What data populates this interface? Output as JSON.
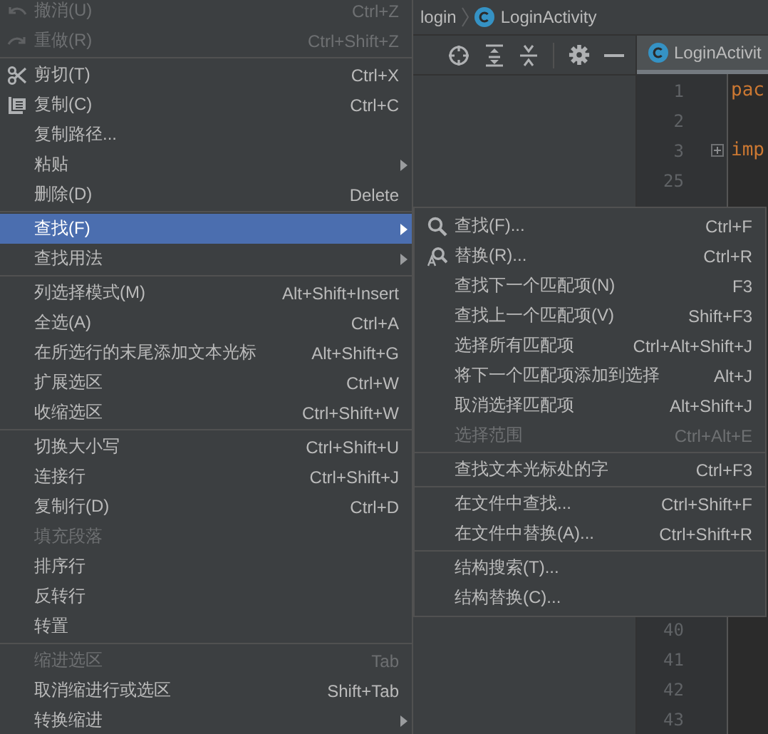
{
  "menu": [
    {
      "kind": "item",
      "label": "撤消(U)",
      "shortcut": "Ctrl+Z",
      "disabled": true,
      "selected": false
    },
    {
      "kind": "item",
      "label": "重做(R)",
      "shortcut": "Ctrl+Shift+Z",
      "disabled": true,
      "selected": false
    },
    {
      "kind": "separator"
    },
    {
      "kind": "item",
      "label": "剪切(T)",
      "shortcut": "Ctrl+X",
      "disabled": false,
      "selected": false
    },
    {
      "kind": "item",
      "label": "复制(C)",
      "shortcut": "Ctrl+C",
      "disabled": false,
      "selected": false
    },
    {
      "kind": "item",
      "label": "复制路径...",
      "disabled": false,
      "selected": false
    },
    {
      "kind": "item",
      "label": "粘贴",
      "disabled": false,
      "selected": false,
      "submenu": true
    },
    {
      "kind": "item",
      "label": "删除(D)",
      "shortcut": "Delete",
      "disabled": false,
      "selected": false
    },
    {
      "kind": "separator"
    },
    {
      "kind": "item",
      "label": "查找(F)",
      "disabled": false,
      "selected": true,
      "submenu": true
    },
    {
      "kind": "item",
      "label": "查找用法",
      "disabled": false,
      "selected": false,
      "submenu": true
    },
    {
      "kind": "separator"
    },
    {
      "kind": "item",
      "label": "列选择模式(M)",
      "shortcut": "Alt+Shift+Insert",
      "disabled": false,
      "selected": false
    },
    {
      "kind": "item",
      "label": "全选(A)",
      "shortcut": "Ctrl+A",
      "disabled": false,
      "selected": false
    },
    {
      "kind": "item",
      "label": "在所选行的末尾添加文本光标",
      "shortcut": "Alt+Shift+G",
      "disabled": false,
      "selected": false
    },
    {
      "kind": "item",
      "label": "扩展选区",
      "shortcut": "Ctrl+W",
      "disabled": false,
      "selected": false
    },
    {
      "kind": "item",
      "label": "收缩选区",
      "shortcut": "Ctrl+Shift+W",
      "disabled": false,
      "selected": false
    },
    {
      "kind": "separator"
    },
    {
      "kind": "item",
      "label": "切换大小写",
      "shortcut": "Ctrl+Shift+U",
      "disabled": false,
      "selected": false
    },
    {
      "kind": "item",
      "label": "连接行",
      "shortcut": "Ctrl+Shift+J",
      "disabled": false,
      "selected": false
    },
    {
      "kind": "item",
      "label": "复制行(D)",
      "shortcut": "Ctrl+D",
      "disabled": false,
      "selected": false
    },
    {
      "kind": "item",
      "label": "填充段落",
      "disabled": true,
      "selected": false
    },
    {
      "kind": "item",
      "label": "排序行",
      "disabled": false,
      "selected": false
    },
    {
      "kind": "item",
      "label": "反转行",
      "disabled": false,
      "selected": false
    },
    {
      "kind": "item",
      "label": "转置",
      "disabled": false,
      "selected": false
    },
    {
      "kind": "separator"
    },
    {
      "kind": "item",
      "label": "缩进选区",
      "shortcut": "Tab",
      "disabled": true,
      "selected": false
    },
    {
      "kind": "item",
      "label": "取消缩进行或选区",
      "shortcut": "Shift+Tab",
      "disabled": false,
      "selected": false
    },
    {
      "kind": "item",
      "label": "转换缩进",
      "disabled": false,
      "selected": false,
      "submenu": true
    }
  ],
  "submenu": [
    {
      "kind": "item",
      "label": "查找(F)...",
      "shortcut": "Ctrl+F",
      "disabled": false,
      "selected": false
    },
    {
      "kind": "item",
      "label": "替换(R)...",
      "shortcut": "Ctrl+R",
      "disabled": false,
      "selected": false
    },
    {
      "kind": "item",
      "label": "查找下一个匹配项(N)",
      "shortcut": "F3",
      "disabled": false,
      "selected": false
    },
    {
      "kind": "item",
      "label": "查找上一个匹配项(V)",
      "shortcut": "Shift+F3",
      "disabled": false,
      "selected": false
    },
    {
      "kind": "item",
      "label": "选择所有匹配项",
      "shortcut": "Ctrl+Alt+Shift+J",
      "disabled": false,
      "selected": false
    },
    {
      "kind": "item",
      "label": "将下一个匹配项添加到选择",
      "shortcut": "Alt+J",
      "disabled": false,
      "selected": false
    },
    {
      "kind": "item",
      "label": "取消选择匹配项",
      "shortcut": "Alt+Shift+J",
      "disabled": false,
      "selected": false
    },
    {
      "kind": "item",
      "label": "选择范围",
      "shortcut": "Ctrl+Alt+E",
      "disabled": true,
      "selected": false
    },
    {
      "kind": "separator"
    },
    {
      "kind": "item",
      "label": "查找文本光标处的字",
      "shortcut": "Ctrl+F3",
      "disabled": false,
      "selected": false
    },
    {
      "kind": "separator"
    },
    {
      "kind": "item",
      "label": "在文件中查找...",
      "shortcut": "Ctrl+Shift+F",
      "disabled": false,
      "selected": false
    },
    {
      "kind": "item",
      "label": "在文件中替换(A)...",
      "shortcut": "Ctrl+Shift+R",
      "disabled": false,
      "selected": false
    },
    {
      "kind": "separator"
    },
    {
      "kind": "item",
      "label": "结构搜索(T)...",
      "disabled": false,
      "selected": false
    },
    {
      "kind": "item",
      "label": "结构替换(C)...",
      "disabled": false,
      "selected": false
    }
  ],
  "breadcrumb": [
    "login",
    "LoginActivity"
  ],
  "editor": {
    "tab": "LoginActivit",
    "top_lines": [
      {
        "number": "1",
        "code": "pac"
      },
      {
        "number": "2"
      },
      {
        "number": "3",
        "code": "imp",
        "folded": true
      },
      {
        "number": "25"
      }
    ],
    "bottom_lines": [
      {
        "number": "40"
      },
      {
        "number": "41"
      },
      {
        "number": "42"
      },
      {
        "number": "43"
      }
    ]
  }
}
